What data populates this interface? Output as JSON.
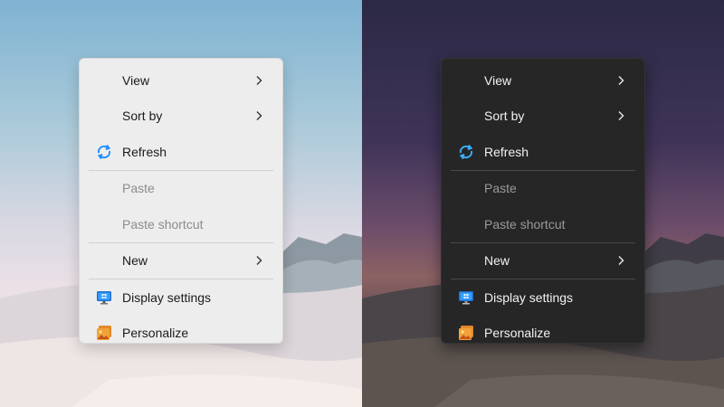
{
  "menus": {
    "light": {
      "view": "View",
      "sort_by": "Sort by",
      "refresh": "Refresh",
      "paste": "Paste",
      "paste_shortcut": "Paste shortcut",
      "new": "New",
      "display_settings": "Display settings",
      "personalize": "Personalize"
    },
    "dark": {
      "view": "View",
      "sort_by": "Sort by",
      "refresh": "Refresh",
      "paste": "Paste",
      "paste_shortcut": "Paste shortcut",
      "new": "New",
      "display_settings": "Display settings",
      "personalize": "Personalize"
    }
  },
  "icons": {
    "refresh": "refresh-icon",
    "display_settings": "monitor-icon",
    "personalize": "personalize-icon",
    "submenu": "chevron-right-icon"
  },
  "colors": {
    "refresh_icon": "#1e90ff",
    "display_icon": "#1f6fd0",
    "personalize_icon": "#f2a23a"
  }
}
